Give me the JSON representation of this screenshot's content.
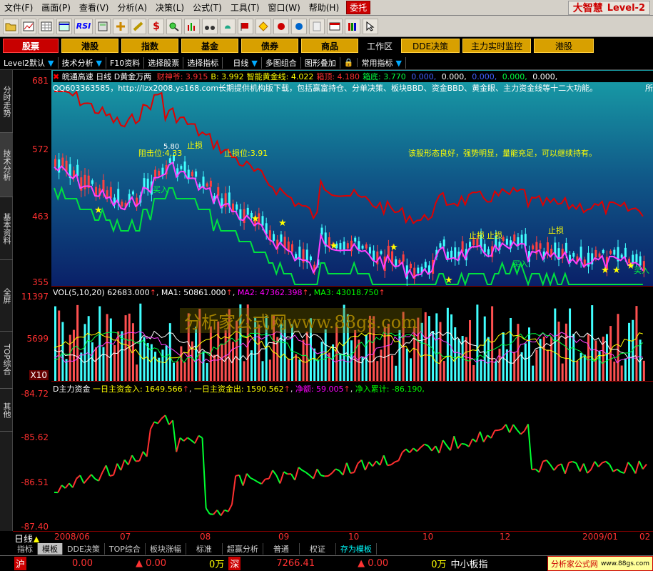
{
  "menubar": {
    "items": [
      "文件(F)",
      "画面(P)",
      "查看(V)",
      "分析(A)",
      "决策(L)",
      "公式(T)",
      "工具(T)",
      "窗口(W)",
      "帮助(H)"
    ],
    "red_item": "委托",
    "brand": "大智慧",
    "brand_level": "Level-2"
  },
  "toolbar": {
    "icons": [
      "folder-icon",
      "chart-icon",
      "grid-icon",
      "table-icon",
      "rsi-icon",
      "calc-icon",
      "move-icon",
      "ruler-icon",
      "dollar-icon",
      "zoom-icon",
      "bars-icon",
      "binoculars-icon",
      "bell-icon",
      "flag-icon",
      "diamond-icon",
      "rocket-icon",
      "alarm-icon",
      "doc-icon",
      "card-icon",
      "books-icon",
      "cursor-icon"
    ],
    "rsi_label": "RSI"
  },
  "marketbar": {
    "items": [
      "股票",
      "港股",
      "指数",
      "基金",
      "债券",
      "商品"
    ],
    "workarea": "工作区",
    "right_items": [
      "DDE决策",
      "主力实时监控",
      "港股"
    ]
  },
  "indbar": {
    "items": [
      "Level2默认",
      "技术分析",
      "F10资料",
      "选择股票",
      "选择指标",
      "日线",
      "多图组合",
      "图形叠加",
      "常用指标"
    ]
  },
  "sidebar": {
    "tabs": [
      "分时走势",
      "技术分析",
      "基本资料",
      "全屏",
      "TOP综合",
      "其他"
    ]
  },
  "main_panel": {
    "stock": "皖通高速",
    "period": "日线",
    "indicator": "D黄金万两",
    "legend": [
      {
        "label": "财神爷:",
        "value": "3.915",
        "color": "#ff3030"
      },
      {
        "label": "B:",
        "value": "3.992",
        "color": "#ffff00"
      },
      {
        "label": "智能黄金线:",
        "value": "4.022",
        "color": "#ffff00"
      },
      {
        "label": "箱顶:",
        "value": "4.180",
        "color": "#ff3030"
      },
      {
        "label": "箱底:",
        "value": "3.770",
        "color": "#00ff40"
      },
      {
        "label": "",
        "value": "0.000,",
        "color": "#4060ff"
      },
      {
        "label": "",
        "value": "0.000,",
        "color": "#ffffff"
      },
      {
        "label": "",
        "value": "0.000,",
        "color": "#4060ff"
      },
      {
        "label": "",
        "value": "0.000,",
        "color": "#00ff40"
      },
      {
        "label": "",
        "value": "0.000,",
        "color": "#ffffff"
      }
    ],
    "notice": "QQ603363585，http://lzx2008.ys168.com长期提供机构版下载，包括赢富持仓、分单决策、板块BBD、资金BBD、黄金眼、主力资金线等十二大功能。",
    "notice_tail": "所",
    "comment": "该股形态良好，强势明显，量能充足，可以继续持有。",
    "annotations": {
      "resist": "阻击位:4.33",
      "stop_loss_level": "止损位:3.91",
      "stop_loss": "止损",
      "buy": "买入",
      "high_marker": "5.80"
    },
    "y_labels": [
      "681",
      "572",
      "463",
      "355"
    ]
  },
  "vol_panel": {
    "title": "VOL(5,10,20)",
    "value": "62683.000",
    "ma1": "MA1: 50861.000",
    "ma2": "MA2: 47362.398",
    "ma3": "MA3: 43018.750",
    "y_labels": [
      "11397",
      "5699",
      "X10"
    ]
  },
  "fund_panel": {
    "title": "D主力资金",
    "in": "一日主资金入: 1649.566",
    "out": "一日主资金出: 1590.562",
    "net": "净额: 59.005",
    "cum": "净入累计: -86.190,",
    "y_labels": [
      "-84.72",
      "-85.62",
      "-86.51",
      "-87.40"
    ]
  },
  "dates": [
    "2008/06",
    "07",
    "08",
    "09",
    "10",
    "11",
    "12",
    "2009/01",
    "02"
  ],
  "period_label": "日线",
  "bottomtabs": [
    "指标",
    "模板",
    "DDE决策",
    "TOP综合",
    "板块涨幅",
    "标准",
    "超赢分析",
    "普通",
    "权证",
    "存为模板"
  ],
  "statusbar": {
    "sh": "沪",
    "sh_val": "0.00",
    "sh_chg": "▲ 0.00",
    "sh_vol": "0万",
    "sz": "深",
    "sz_val": "7266.41",
    "sz_chg": "▲ 0.00",
    "sz_vol": "0万",
    "sme": "中小板指",
    "promo": "分析家公式网",
    "promo_url": "www.88gs.com"
  },
  "watermark": "分析家公式网www.88gs.com",
  "chart_data": {
    "type": "line",
    "candle_price_range": [
      3.55,
      6.81
    ],
    "volume_range": [
      0,
      11397
    ],
    "fund_range": [
      -87.4,
      -84.72
    ]
  }
}
